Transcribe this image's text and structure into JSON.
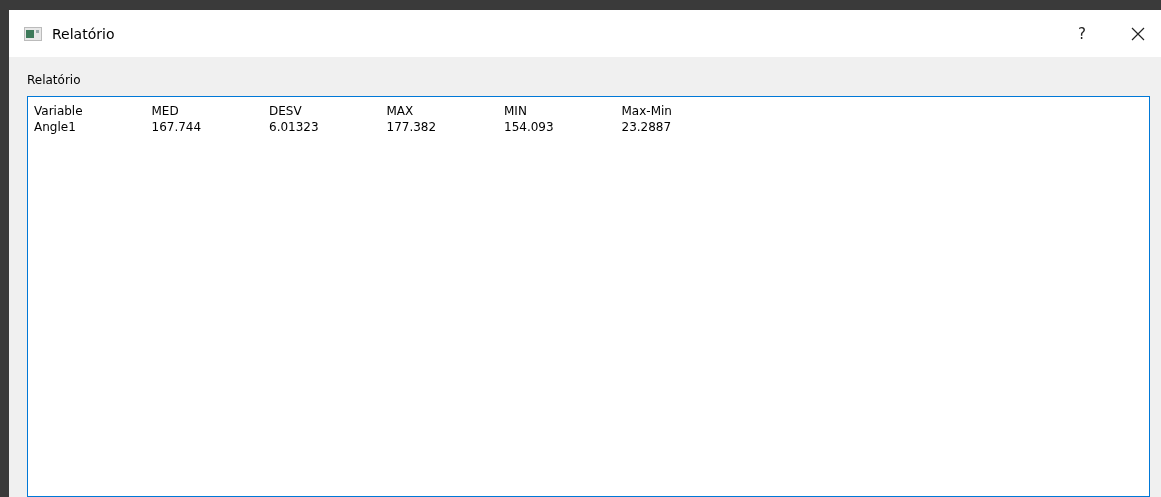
{
  "window": {
    "title": "Relatório",
    "help": "?"
  },
  "group_label": "Relatório",
  "report": {
    "columns": [
      "Variable",
      "MED",
      "DESV",
      "MAX",
      "MIN",
      "Max-Min"
    ],
    "rows": [
      [
        "Angle1",
        "167.744",
        "6.01323",
        "177.382",
        "154.093",
        "23.2887"
      ]
    ]
  }
}
